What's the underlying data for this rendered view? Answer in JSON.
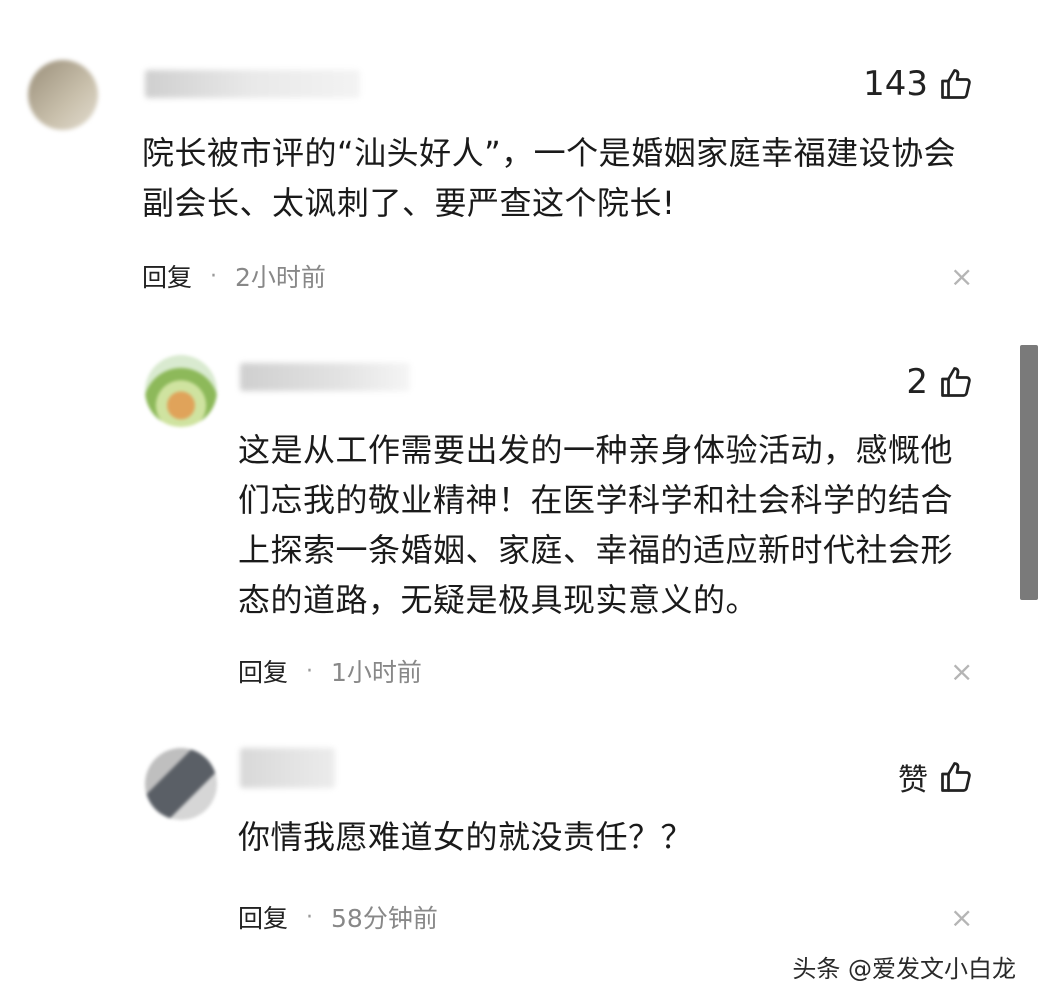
{
  "comments": [
    {
      "likes": "143",
      "text_lines": [
        "院长被市评的“汕头好人”，一个是婚姻家庭幸福建设协会",
        "副会长、太讽刺了、要严查这个院长!"
      ],
      "reply_label": "回复",
      "separator": "·",
      "time": "2小时前"
    },
    {
      "likes": "2",
      "text_lines": [
        "这是从工作需要出发的一种亲身体验活动，感慨他",
        "们忘我的敬业精神！在医学科学和社会科学的结合",
        "上探索一条婚姻、家庭、幸福的适应新时代社会形",
        "态的道路，无疑是极具现实意义的。"
      ],
      "reply_label": "回复",
      "separator": "·",
      "time": "1小时前"
    },
    {
      "likes": "赞",
      "text_lines": [
        "你情我愿难道女的就没责任？？"
      ],
      "reply_label": "回复",
      "separator": "·",
      "time": "58分钟前"
    }
  ],
  "icons": {
    "like": "thumbs-up-icon",
    "close": "close-icon"
  },
  "close_glyph": "×",
  "watermark": "头条 @爱发文小白龙"
}
